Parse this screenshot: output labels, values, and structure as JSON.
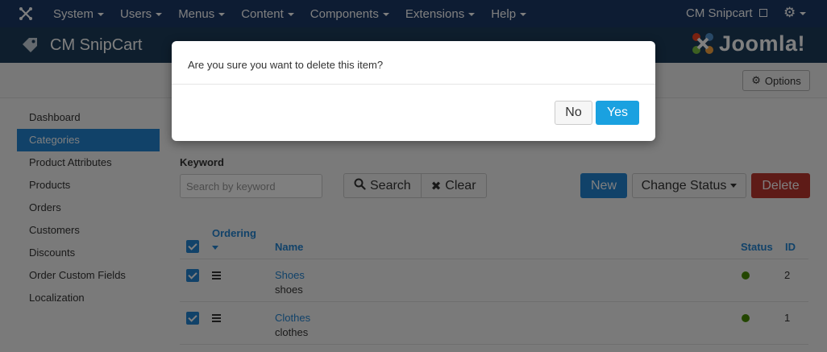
{
  "topnav": {
    "logo_icon": "joomla-icon",
    "menu": [
      {
        "label": "System"
      },
      {
        "label": "Users"
      },
      {
        "label": "Menus"
      },
      {
        "label": "Content"
      },
      {
        "label": "Components"
      },
      {
        "label": "Extensions"
      },
      {
        "label": "Help"
      }
    ],
    "site_link": "CM Snipcart",
    "settings_icon": "gear-icon"
  },
  "header": {
    "title": "CM SnipCart",
    "brand_word": "Joomla!",
    "title_icon": "tag-icon"
  },
  "toolbar": {
    "options_label": "Options"
  },
  "sidebar": {
    "items": [
      {
        "label": "Dashboard",
        "active": false
      },
      {
        "label": "Categories",
        "active": true
      },
      {
        "label": "Product Attributes",
        "active": false
      },
      {
        "label": "Products",
        "active": false
      },
      {
        "label": "Orders",
        "active": false
      },
      {
        "label": "Customers",
        "active": false
      },
      {
        "label": "Discounts",
        "active": false
      },
      {
        "label": "Order Custom Fields",
        "active": false
      },
      {
        "label": "Localization",
        "active": false
      }
    ]
  },
  "filter": {
    "keyword_label": "Keyword",
    "keyword_placeholder": "Search by keyword",
    "search_label": "Search",
    "clear_label": "Clear"
  },
  "actions": {
    "new_label": "New",
    "change_status_label": "Change Status",
    "delete_label": "Delete"
  },
  "table": {
    "headers": {
      "ordering": "Ordering",
      "name": "Name",
      "status": "Status",
      "id": "ID"
    },
    "rows": [
      {
        "name": "Shoes",
        "alias": "shoes",
        "status": "published",
        "id": "2",
        "checked": true
      },
      {
        "name": "Clothes",
        "alias": "clothes",
        "status": "published",
        "id": "1",
        "checked": true
      }
    ]
  },
  "modal": {
    "message": "Are you sure you want to delete this item?",
    "no_label": "No",
    "yes_label": "Yes"
  },
  "colors": {
    "topnav": "#1a3867",
    "header": "#1c3d5a",
    "accent": "#2384d3",
    "yes_button": "#1aa1e0",
    "delete_button": "#bd362f",
    "status_published": "#468c00"
  }
}
